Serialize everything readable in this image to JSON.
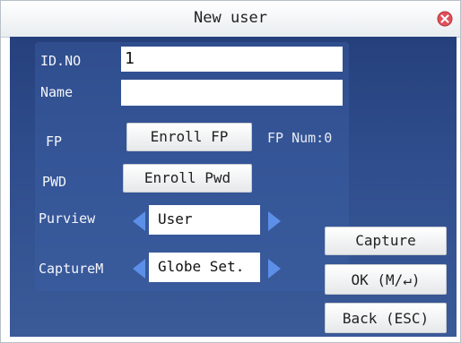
{
  "window": {
    "title": "New user"
  },
  "form": {
    "id_label": "ID.NO",
    "id_value": "1",
    "name_label": "Name",
    "name_value": "",
    "fp_label": "FP",
    "enroll_fp_label": "Enroll  FP",
    "fp_num_text": "FP Num:0",
    "pwd_label": "PWD",
    "enroll_pwd_label": "Enroll  Pwd",
    "purview_label": "Purview",
    "purview_value": "User",
    "capture_mode_label": "CaptureM",
    "capture_mode_value": "Globe Set."
  },
  "actions": {
    "capture_label": "Capture",
    "ok_label": "OK (M/↵)",
    "back_label": "Back (ESC)"
  },
  "colors": {
    "screen_bg": "#2f4d8c",
    "arrow": "#5b8fe8",
    "close": "#e0505a"
  },
  "icons": {
    "close": "close-icon",
    "left_arrow": "left-arrow-icon",
    "right_arrow": "right-arrow-icon"
  }
}
